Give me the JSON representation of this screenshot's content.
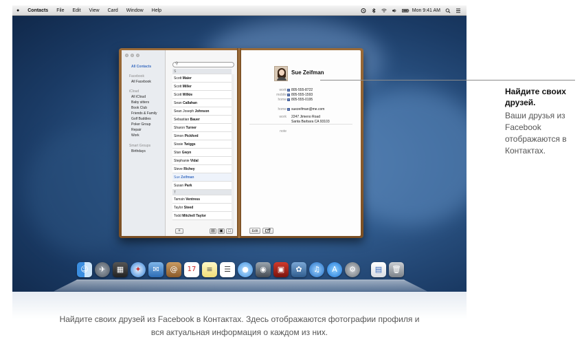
{
  "menubar": {
    "apple": "",
    "app": "Contacts",
    "items": [
      "File",
      "Edit",
      "View",
      "Card",
      "Window",
      "Help"
    ],
    "clock": "Mon 9:41 AM"
  },
  "sidebar": {
    "all_contacts": "All Contacts",
    "facebook_header": "Facebook",
    "all_facebook": "All Facebook",
    "icloud_header": "iCloud",
    "icloud_items": [
      "All iCloud",
      "Baby sitters",
      "Book Club",
      "Friends & Family",
      "Golf Buddies",
      "Poker Group",
      "Repair",
      "Work"
    ],
    "smart_header": "Smart Groups",
    "smart_items": [
      "Birthdays"
    ]
  },
  "list": {
    "search_icon": "search-icon",
    "section_s": "S",
    "section_t": "T",
    "contacts": [
      {
        "first": "Scott ",
        "last": "Maier"
      },
      {
        "first": "Scott ",
        "last": "Miller"
      },
      {
        "first": "Scott ",
        "last": "Wilkie"
      },
      {
        "first": "Sean ",
        "last": "Callahan"
      },
      {
        "first": "Sean Joseph ",
        "last": "Johnson"
      },
      {
        "first": "Sebastian ",
        "last": "Bauer"
      },
      {
        "first": "Sharon ",
        "last": "Turner"
      },
      {
        "first": "Simon ",
        "last": "Pickford"
      },
      {
        "first": "Sissie ",
        "last": "Twiggs"
      },
      {
        "first": "Stan ",
        "last": "Gwyn"
      },
      {
        "first": "Stephanie ",
        "last": "Vidal"
      },
      {
        "first": "Steve ",
        "last": "Richey"
      },
      {
        "first": "Sue ",
        "last": "Zeifman"
      },
      {
        "first": "Susan ",
        "last": "Park"
      },
      {
        "first": "Tamsin ",
        "last": "Ventress"
      },
      {
        "first": "Taylor ",
        "last": "Steed"
      },
      {
        "first": "Todd ",
        "last": "Mitchell Taylor"
      }
    ],
    "add_label": "+"
  },
  "card": {
    "name": "Sue Zeifman",
    "fields": [
      {
        "label": "work",
        "value": "805-555-8722"
      },
      {
        "label": "mobile",
        "value": "805-555-1593"
      },
      {
        "label": "home",
        "value": "805-555-0195"
      },
      {
        "label": "home",
        "value": "suezeifman@me.com"
      },
      {
        "label": "work",
        "value": "2247 Jimeno Road"
      },
      {
        "label": "",
        "value": "Santa Barbara CA 93103"
      }
    ],
    "note_label": "note",
    "edit_label": "Edit",
    "facebook_badge": "f"
  },
  "callout": {
    "title": "Найдите своих друзей.",
    "body": "Ваши друзья из Facebook отображаются в Контактах."
  },
  "caption": {
    "line1": "Найдите своих друзей из Facebook в Контактах. Здесь отображаются фотографии профиля и",
    "line2": "вся актуальная информация о каждом из них."
  },
  "dock": {
    "icons": [
      "finder-icon",
      "launchpad-icon",
      "mission-control-icon",
      "safari-icon",
      "mail-icon",
      "contacts-icon",
      "calendar-icon",
      "notes-icon",
      "reminders-icon",
      "messages-icon",
      "facetime-icon",
      "photo-booth-icon",
      "iphoto-icon",
      "itunes-icon",
      "app-store-icon",
      "system-preferences-icon",
      "documents-icon",
      "trash-icon"
    ]
  }
}
